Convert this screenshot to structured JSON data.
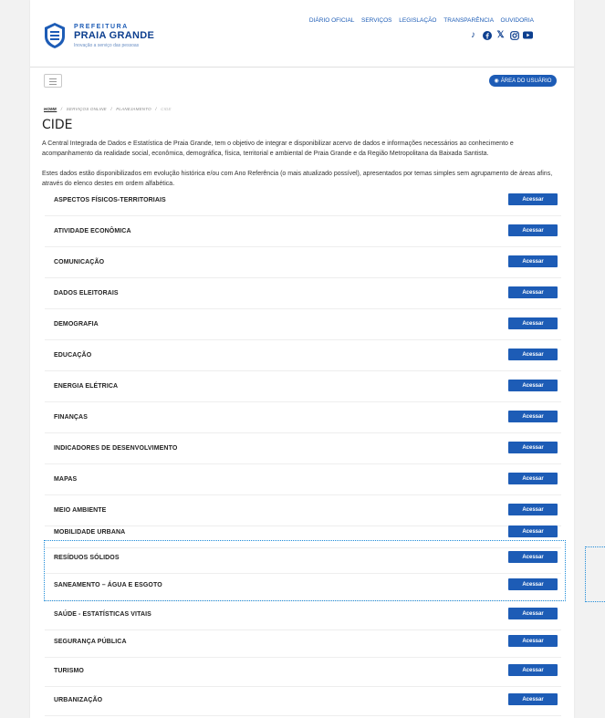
{
  "header": {
    "logo": {
      "pre": "PREFEITURA",
      "name": "PRAIA GRANDE",
      "tagline": "Inovação a serviço das pessoas"
    },
    "topnav": [
      "DIÁRIO OFICIAL",
      "SERVIÇOS",
      "LEGISLAÇÃO",
      "TRANSPARÊNCIA",
      "OUVIDORIA"
    ],
    "social": [
      "tiktok-icon",
      "facebook-icon",
      "x-icon",
      "instagram-icon",
      "youtube-icon"
    ],
    "user_button": "ÁREA DO USUÁRIO"
  },
  "breadcrumb": {
    "home": "HOME",
    "items": [
      "SERVIÇOS ONLINE",
      "PLANEJAMENTO",
      "CIDE"
    ]
  },
  "page": {
    "title": "CIDE",
    "paragraph1": "A Central Integrada de Dados e Estatística de Praia Grande, tem o objetivo de integrar e disponibilizar acervo de dados e informações necessários ao conhecimento e acompanhamento da realidade social, econômica, demográfica, física, territorial e ambiental de Praia Grande e da Região Metropolitana da Baixada Santista.",
    "paragraph2": "Estes dados estão disponibilizados em evolução histórica e/ou com Ano Referência (o mais atualizado possível), apresentados por temas simples sem agrupamento de áreas afins, através do elenco destes em ordem alfabética."
  },
  "categories": {
    "button_label": "Acessar",
    "items": [
      "ASPECTOS FÍSICOS-TERRITORIAIS",
      "ATIVIDADE ECONÔMICA",
      "COMUNICAÇÃO",
      "DADOS ELEITORAIS",
      "DEMOGRAFIA",
      "EDUCAÇÃO",
      "ENERGIA ELÉTRICA",
      "FINANÇAS",
      "INDICADORES DE DESENVOLVIMENTO",
      "MAPAS",
      "MEIO AMBIENTE",
      "MOBILIDADE URBANA",
      "RESÍDUOS SÓLIDOS",
      "SANEAMENTO – ÁGUA E ESGOTO",
      "SAÚDE - ESTATÍSTICAS VITAIS",
      "SEGURANÇA PÚBLICA",
      "TURISMO",
      "URBANIZAÇÃO"
    ]
  },
  "colors": {
    "primary": "#1d5cb6",
    "selection": "#1d8bd8"
  }
}
